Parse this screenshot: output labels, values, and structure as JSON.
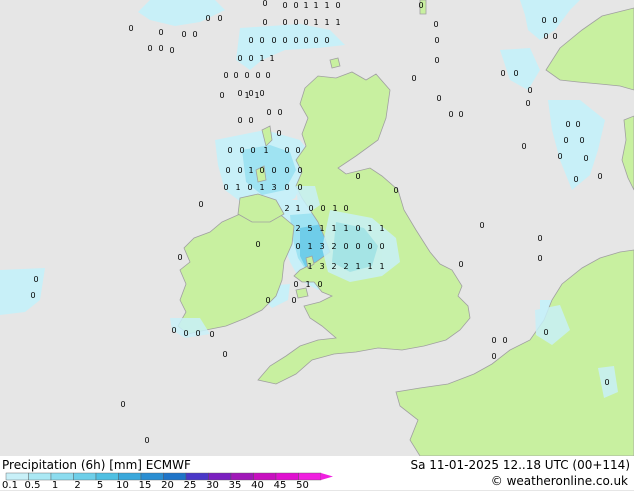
{
  "title": "Precipitation (6h) [mm] ECMWF",
  "datetime": "Sa 11-01-2025 12..18 UTC (00+114)",
  "credit": "© weatheronline.co.uk",
  "legend": {
    "ticks": [
      "0.1",
      "0.5",
      "1",
      "2",
      "5",
      "10",
      "15",
      "20",
      "25",
      "30",
      "35",
      "40",
      "45",
      "50"
    ],
    "colors": [
      "#c8f0f8",
      "#aae8f4",
      "#8cdcef",
      "#6ecfe9",
      "#50c0e2",
      "#3aa8db",
      "#2a8ed2",
      "#1e74c8",
      "#4a38c8",
      "#7a20c0",
      "#a018b8",
      "#c810c0",
      "#e010d0",
      "#f020e0"
    ]
  },
  "colors": {
    "sea": "#e6e6e6",
    "land": "#c8f0a0",
    "coast": "#a0a0a0",
    "precip_light": "#c8f0f8",
    "precip_mid": "#9fe3f2",
    "precip_heavy": "#6fcde9"
  },
  "map_labels": [
    [
      "0",
      265,
      3
    ],
    [
      "0",
      285,
      5
    ],
    [
      "0",
      296,
      5
    ],
    [
      "1",
      306,
      5
    ],
    [
      "1",
      316,
      5
    ],
    [
      "1",
      327,
      5
    ],
    [
      "0",
      338,
      5
    ],
    [
      "0",
      208,
      18
    ],
    [
      "0",
      220,
      18
    ],
    [
      "0",
      265,
      22
    ],
    [
      "0",
      285,
      22
    ],
    [
      "0",
      296,
      22
    ],
    [
      "0",
      306,
      22
    ],
    [
      "1",
      316,
      22
    ],
    [
      "1",
      327,
      22
    ],
    [
      "1",
      338,
      22
    ],
    [
      "0",
      131,
      28
    ],
    [
      "0",
      161,
      32
    ],
    [
      "0",
      184,
      34
    ],
    [
      "0",
      195,
      34
    ],
    [
      "0",
      251,
      40
    ],
    [
      "0",
      262,
      40
    ],
    [
      "0",
      274,
      40
    ],
    [
      "0",
      285,
      40
    ],
    [
      "0",
      296,
      40
    ],
    [
      "0",
      306,
      40
    ],
    [
      "0",
      316,
      40
    ],
    [
      "0",
      327,
      40
    ],
    [
      "0",
      150,
      48
    ],
    [
      "0",
      161,
      48
    ],
    [
      "0",
      172,
      50
    ],
    [
      "0",
      240,
      58
    ],
    [
      "0",
      251,
      58
    ],
    [
      "1",
      262,
      58
    ],
    [
      "1",
      272,
      58
    ],
    [
      "0",
      226,
      75
    ],
    [
      "0",
      236,
      75
    ],
    [
      "0",
      247,
      75
    ],
    [
      "0",
      258,
      75
    ],
    [
      "0",
      268,
      75
    ],
    [
      "0",
      240,
      93
    ],
    [
      "0",
      251,
      93
    ],
    [
      "0",
      262,
      93
    ],
    [
      "0",
      222,
      95
    ],
    [
      "1",
      247,
      95
    ],
    [
      "1",
      257,
      95
    ],
    [
      "0",
      269,
      112
    ],
    [
      "0",
      280,
      112
    ],
    [
      "0",
      240,
      120
    ],
    [
      "0",
      251,
      120
    ],
    [
      "0",
      279,
      133
    ],
    [
      "0",
      230,
      150
    ],
    [
      "0",
      242,
      150
    ],
    [
      "0",
      253,
      150
    ],
    [
      "1",
      266,
      150
    ],
    [
      "0",
      287,
      150
    ],
    [
      "0",
      298,
      150
    ],
    [
      "0",
      228,
      170
    ],
    [
      "0",
      240,
      170
    ],
    [
      "1",
      251,
      170
    ],
    [
      "0",
      262,
      170
    ],
    [
      "0",
      274,
      170
    ],
    [
      "0",
      287,
      170
    ],
    [
      "0",
      300,
      170
    ],
    [
      "0",
      226,
      187
    ],
    [
      "1",
      238,
      187
    ],
    [
      "0",
      250,
      187
    ],
    [
      "1",
      262,
      187
    ],
    [
      "3",
      274,
      187
    ],
    [
      "0",
      287,
      187
    ],
    [
      "0",
      300,
      187
    ],
    [
      "0",
      201,
      204
    ],
    [
      "2",
      287,
      208
    ],
    [
      "1",
      298,
      208
    ],
    [
      "0",
      311,
      208
    ],
    [
      "0",
      323,
      208
    ],
    [
      "1",
      335,
      208
    ],
    [
      "0",
      346,
      208
    ],
    [
      "2",
      298,
      228
    ],
    [
      "5",
      310,
      228
    ],
    [
      "1",
      322,
      228
    ],
    [
      "1",
      334,
      228
    ],
    [
      "1",
      346,
      228
    ],
    [
      "0",
      358,
      228
    ],
    [
      "1",
      370,
      228
    ],
    [
      "1",
      382,
      228
    ],
    [
      "0",
      298,
      246
    ],
    [
      "1",
      310,
      246
    ],
    [
      "3",
      322,
      246
    ],
    [
      "2",
      334,
      246
    ],
    [
      "0",
      346,
      246
    ],
    [
      "0",
      358,
      246
    ],
    [
      "0",
      370,
      246
    ],
    [
      "0",
      382,
      246
    ],
    [
      "1",
      310,
      266
    ],
    [
      "3",
      322,
      266
    ],
    [
      "2",
      334,
      266
    ],
    [
      "2",
      346,
      266
    ],
    [
      "1",
      358,
      266
    ],
    [
      "1",
      370,
      266
    ],
    [
      "1",
      382,
      266
    ],
    [
      "0",
      296,
      284
    ],
    [
      "1",
      308,
      284
    ],
    [
      "0",
      320,
      284
    ],
    [
      "0",
      294,
      300
    ],
    [
      "0",
      358,
      176
    ],
    [
      "0",
      396,
      190
    ],
    [
      "0",
      258,
      244
    ],
    [
      "0",
      180,
      257
    ],
    [
      "0",
      36,
      279
    ],
    [
      "0",
      33,
      295
    ],
    [
      "0",
      461,
      264
    ],
    [
      "0",
      268,
      300
    ],
    [
      "0",
      174,
      330
    ],
    [
      "0",
      186,
      333
    ],
    [
      "0",
      198,
      333
    ],
    [
      "0",
      212,
      334
    ],
    [
      "0",
      225,
      354
    ],
    [
      "0",
      123,
      404
    ],
    [
      "0",
      147,
      440
    ],
    [
      "0",
      494,
      340
    ],
    [
      "0",
      505,
      340
    ],
    [
      "0",
      546,
      332
    ],
    [
      "0",
      494,
      356
    ],
    [
      "0",
      607,
      382
    ],
    [
      "0",
      421,
      5
    ],
    [
      "0",
      436,
      24
    ],
    [
      "0",
      437,
      40
    ],
    [
      "0",
      437,
      60
    ],
    [
      "0",
      414,
      78
    ],
    [
      "0",
      439,
      98
    ],
    [
      "0",
      451,
      114
    ],
    [
      "0",
      461,
      114
    ],
    [
      "0",
      544,
      20
    ],
    [
      "0",
      555,
      20
    ],
    [
      "0",
      546,
      36
    ],
    [
      "0",
      555,
      36
    ],
    [
      "0",
      503,
      73
    ],
    [
      "0",
      516,
      73
    ],
    [
      "0",
      530,
      90
    ],
    [
      "0",
      528,
      103
    ],
    [
      "0",
      568,
      124
    ],
    [
      "0",
      578,
      124
    ],
    [
      "0",
      566,
      140
    ],
    [
      "0",
      582,
      140
    ],
    [
      "0",
      524,
      146
    ],
    [
      "0",
      586,
      158
    ],
    [
      "0",
      560,
      156
    ],
    [
      "0",
      600,
      176
    ],
    [
      "0",
      576,
      179
    ],
    [
      "0",
      482,
      225
    ],
    [
      "0",
      540,
      238
    ],
    [
      "0",
      540,
      258
    ]
  ]
}
